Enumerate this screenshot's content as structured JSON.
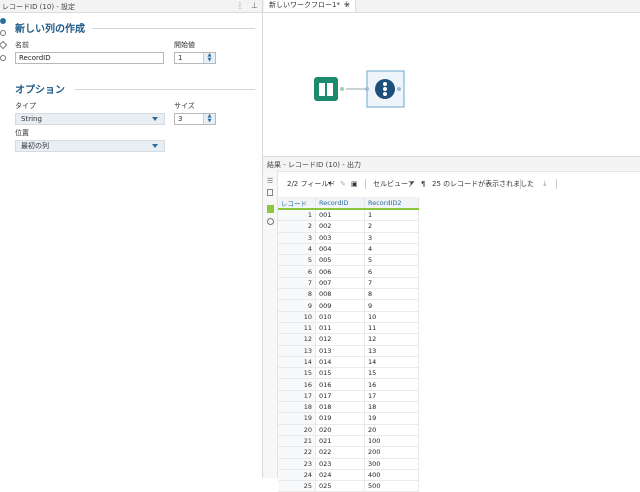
{
  "left_panel": {
    "title": "レコードID (10) - 設定",
    "section_new_col": "新しい列の作成",
    "label_name": "名前",
    "name_value": "RecordID",
    "label_start": "開始値",
    "start_value": "1",
    "section_options": "オプション",
    "label_type": "タイプ",
    "type_value": "String",
    "label_size": "サイズ",
    "size_value": "3",
    "label_position": "位置",
    "position_value": "最初の列"
  },
  "canvas": {
    "tabs": [
      {
        "label": "新しいワークフロー1*",
        "close": "×"
      },
      {
        "label": "+"
      }
    ]
  },
  "results": {
    "title": "結果 - レコードID (10) - 出力",
    "fields_label": "2/2 フィールド",
    "cell_viewer_label": "セルビューア",
    "records_msg": "25 のレコードが表示されました",
    "columns": [
      "レコード",
      "RecordID",
      "RecordID2"
    ],
    "rows": [
      [
        "1",
        "001",
        "1"
      ],
      [
        "2",
        "002",
        "2"
      ],
      [
        "3",
        "003",
        "3"
      ],
      [
        "4",
        "004",
        "4"
      ],
      [
        "5",
        "005",
        "5"
      ],
      [
        "6",
        "006",
        "6"
      ],
      [
        "7",
        "007",
        "7"
      ],
      [
        "8",
        "008",
        "8"
      ],
      [
        "9",
        "009",
        "9"
      ],
      [
        "10",
        "010",
        "10"
      ],
      [
        "11",
        "011",
        "11"
      ],
      [
        "12",
        "012",
        "12"
      ],
      [
        "13",
        "013",
        "13"
      ],
      [
        "14",
        "014",
        "14"
      ],
      [
        "15",
        "015",
        "15"
      ],
      [
        "16",
        "016",
        "16"
      ],
      [
        "17",
        "017",
        "17"
      ],
      [
        "18",
        "018",
        "18"
      ],
      [
        "19",
        "019",
        "19"
      ],
      [
        "20",
        "020",
        "20"
      ],
      [
        "21",
        "021",
        "100"
      ],
      [
        "22",
        "022",
        "200"
      ],
      [
        "23",
        "023",
        "300"
      ],
      [
        "24",
        "024",
        "400"
      ],
      [
        "25",
        "025",
        "500"
      ]
    ]
  },
  "colors": {
    "accent_blue": "#1f5a86",
    "tool_green": "#1b8a6e",
    "tool_navy": "#1d4f7a",
    "header_underline": "#8cc63f"
  }
}
